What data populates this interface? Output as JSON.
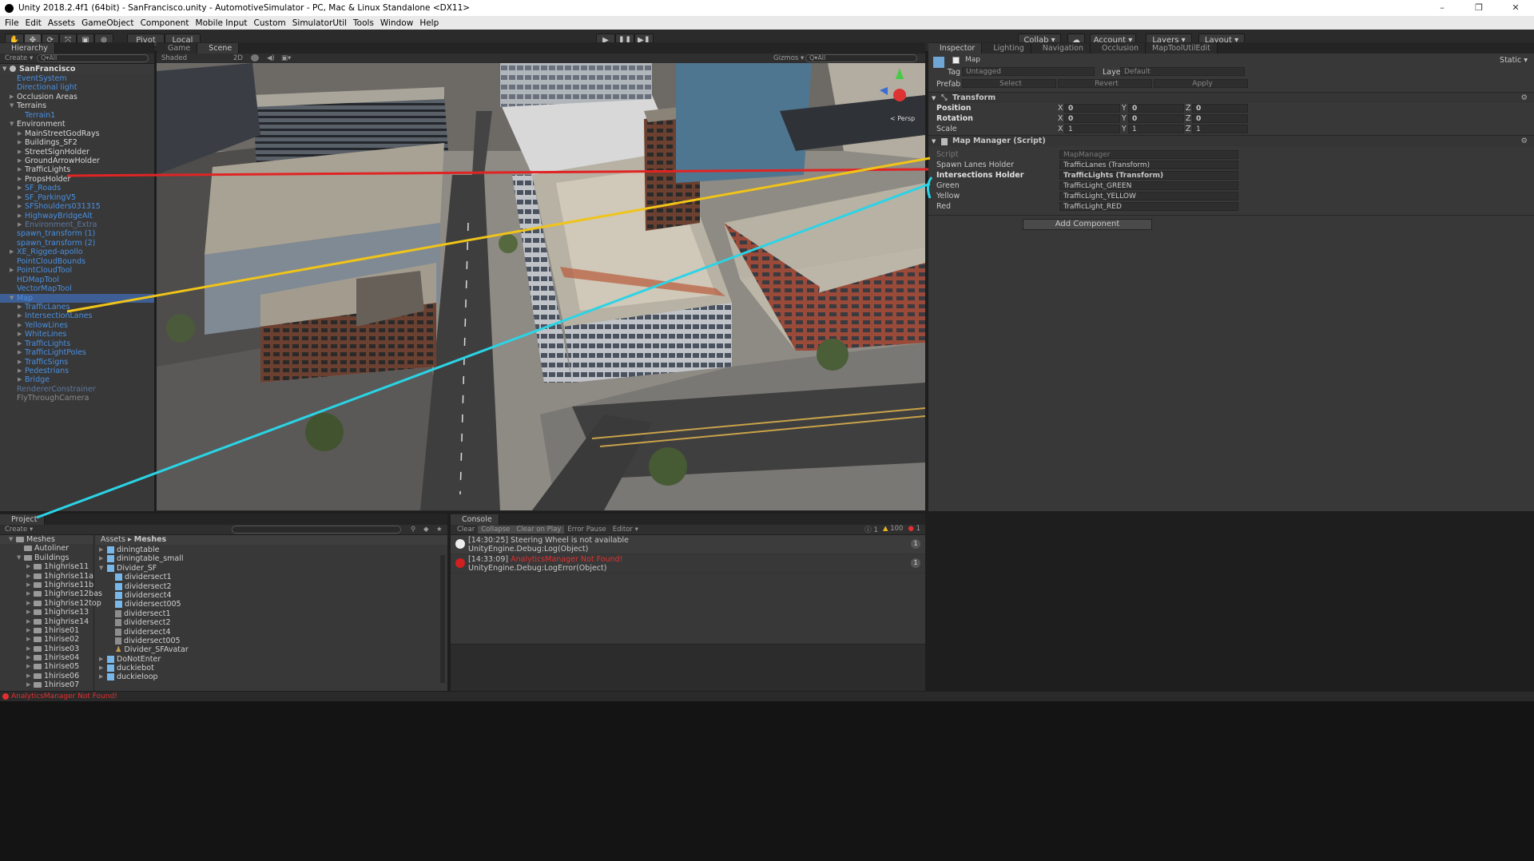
{
  "window": {
    "title": "Unity 2018.2.4f1 (64bit) - SanFrancisco.unity - AutomotiveSimulator - PC, Mac & Linux Standalone <DX11>",
    "controls": [
      "–",
      "❐",
      "✕"
    ]
  },
  "menu": [
    "File",
    "Edit",
    "Assets",
    "GameObject",
    "Component",
    "Mobile Input",
    "Custom",
    "SimulatorUtil",
    "Tools",
    "Window",
    "Help"
  ],
  "toolbar": {
    "pivot": "Pivot",
    "local": "Local",
    "collab": "Collab ▾",
    "account": "Account ▾",
    "layers": "Layers ▾",
    "layout": "Layout ▾"
  },
  "hierarchy": {
    "tab": "Hierarchy",
    "create": "Create ▾",
    "search_placeholder": "Q▾All",
    "scene": "SanFrancisco",
    "items": [
      {
        "label": "EventSystem",
        "indent": 1,
        "color": "blue",
        "arrow": ""
      },
      {
        "label": "Directional light",
        "indent": 1,
        "color": "blue",
        "arrow": ""
      },
      {
        "label": "Occlusion Areas",
        "indent": 1,
        "color": "white",
        "arrow": "▶"
      },
      {
        "label": "Terrains",
        "indent": 1,
        "color": "white",
        "arrow": "▼"
      },
      {
        "label": "Terrain1",
        "indent": 2,
        "color": "blue",
        "arrow": ""
      },
      {
        "label": "Environment",
        "indent": 1,
        "color": "white",
        "arrow": "▼"
      },
      {
        "label": "MainStreetGodRays",
        "indent": 2,
        "color": "white",
        "arrow": "▶"
      },
      {
        "label": "Buildings_SF2",
        "indent": 2,
        "color": "white",
        "arrow": "▶"
      },
      {
        "label": "StreetSignHolder",
        "indent": 2,
        "color": "white",
        "arrow": "▶"
      },
      {
        "label": "GroundArrowHolder",
        "indent": 2,
        "color": "white",
        "arrow": "▶"
      },
      {
        "label": "TrafficLights",
        "indent": 2,
        "color": "white",
        "arrow": "▶"
      },
      {
        "label": "PropsHolder",
        "indent": 2,
        "color": "white",
        "arrow": "▶"
      },
      {
        "label": "SF_Roads",
        "indent": 2,
        "color": "blue",
        "arrow": "▶"
      },
      {
        "label": "SF_ParkingV5",
        "indent": 2,
        "color": "blue",
        "arrow": "▶"
      },
      {
        "label": "SFShoulders031315",
        "indent": 2,
        "color": "blue",
        "arrow": "▶"
      },
      {
        "label": "HighwayBridgeAlt",
        "indent": 2,
        "color": "blue",
        "arrow": "▶"
      },
      {
        "label": "Environment_Extra",
        "indent": 2,
        "color": "dim",
        "arrow": "▶"
      },
      {
        "label": "spawn_transform (1)",
        "indent": 1,
        "color": "blue",
        "arrow": ""
      },
      {
        "label": "spawn_transform (2)",
        "indent": 1,
        "color": "blue",
        "arrow": ""
      },
      {
        "label": "XE_Rigged-apollo",
        "indent": 1,
        "color": "blue",
        "arrow": "▶"
      },
      {
        "label": "PointCloudBounds",
        "indent": 1,
        "color": "blue",
        "arrow": ""
      },
      {
        "label": "PointCloudTool",
        "indent": 1,
        "color": "blue",
        "arrow": "▶"
      },
      {
        "label": "HDMapTool",
        "indent": 1,
        "color": "blue",
        "arrow": ""
      },
      {
        "label": "VectorMapTool",
        "indent": 1,
        "color": "blue",
        "arrow": ""
      },
      {
        "label": "Map",
        "indent": 1,
        "color": "blue",
        "arrow": "▼",
        "selected": true
      },
      {
        "label": "TrafficLanes",
        "indent": 2,
        "color": "blue",
        "arrow": "▶"
      },
      {
        "label": "IntersectionLanes",
        "indent": 2,
        "color": "blue",
        "arrow": "▶"
      },
      {
        "label": "YellowLines",
        "indent": 2,
        "color": "blue",
        "arrow": "▶"
      },
      {
        "label": "WhiteLines",
        "indent": 2,
        "color": "blue",
        "arrow": "▶"
      },
      {
        "label": "TrafficLights",
        "indent": 2,
        "color": "blue",
        "arrow": "▶"
      },
      {
        "label": "TrafficLightPoles",
        "indent": 2,
        "color": "blue",
        "arrow": "▶"
      },
      {
        "label": "TrafficSigns",
        "indent": 2,
        "color": "blue",
        "arrow": "▶"
      },
      {
        "label": "Pedestrians",
        "indent": 2,
        "color": "blue",
        "arrow": "▶"
      },
      {
        "label": "Bridge",
        "indent": 2,
        "color": "blue",
        "arrow": "▶"
      },
      {
        "label": "RendererConstrainer",
        "indent": 1,
        "color": "dim",
        "arrow": ""
      },
      {
        "label": "FlyThroughCamera",
        "indent": 1,
        "color": "gray",
        "arrow": ""
      }
    ]
  },
  "scene_view": {
    "tabs": [
      "Game",
      "Scene"
    ],
    "shading": "Shaded",
    "mode_2d": "2D",
    "gizmos": "Gizmos ▾",
    "search_placeholder": "Q▾All",
    "persp": "< Persp"
  },
  "inspector": {
    "tabs": [
      "Inspector",
      "Lighting",
      "Navigation",
      "Occlusion",
      "MapToolUtilEdit"
    ],
    "object_name": "Map",
    "static": "Static ▾",
    "tag_label": "Tag",
    "tag_value": "Untagged",
    "layer_label": "Layer",
    "layer_value": "Default",
    "prefab_label": "Prefab",
    "prefab_select": "Select",
    "prefab_revert": "Revert",
    "prefab_apply": "Apply",
    "transform": {
      "title": "Transform",
      "position_label": "Position",
      "rotation_label": "Rotation",
      "scale_label": "Scale",
      "position": [
        "0",
        "0",
        "0"
      ],
      "rotation": [
        "0",
        "0",
        "0"
      ],
      "scale": [
        "1",
        "1",
        "1"
      ]
    },
    "map_manager": {
      "title": "Map Manager (Script)",
      "script_label": "Script",
      "script_value": "MapManager",
      "spawn_label": "Spawn Lanes Holder",
      "spawn_value": "TrafficLanes (Transform)",
      "intersections_label": "Intersections Holder",
      "intersections_value": "TrafficLights (Transform)",
      "green_label": "Green",
      "green_value": "TrafficLight_GREEN",
      "yellow_label": "Yellow",
      "yellow_value": "TrafficLight_YELLOW",
      "red_label": "Red",
      "red_value": "TrafficLight_RED"
    },
    "add_component": "Add Component"
  },
  "project": {
    "tab": "Project",
    "create": "Create ▾",
    "tree": [
      {
        "label": "Meshes",
        "indent": 1,
        "arrow": "▼"
      },
      {
        "label": "Autoliner",
        "indent": 2,
        "arrow": ""
      },
      {
        "label": "Buildings",
        "indent": 2,
        "arrow": "▼"
      },
      {
        "label": "1highrise11",
        "indent": 3,
        "arrow": "▶"
      },
      {
        "label": "1highrise11a",
        "indent": 3,
        "arrow": "▶"
      },
      {
        "label": "1highrise11b",
        "indent": 3,
        "arrow": "▶"
      },
      {
        "label": "1highrise12bas",
        "indent": 3,
        "arrow": "▶"
      },
      {
        "label": "1highrise12top",
        "indent": 3,
        "arrow": "▶"
      },
      {
        "label": "1highrise13",
        "indent": 3,
        "arrow": "▶"
      },
      {
        "label": "1highrise14",
        "indent": 3,
        "arrow": "▶"
      },
      {
        "label": "1hirise01",
        "indent": 3,
        "arrow": "▶"
      },
      {
        "label": "1hirise02",
        "indent": 3,
        "arrow": "▶"
      },
      {
        "label": "1hirise03",
        "indent": 3,
        "arrow": "▶"
      },
      {
        "label": "1hirise04",
        "indent": 3,
        "arrow": "▶"
      },
      {
        "label": "1hirise05",
        "indent": 3,
        "arrow": "▶"
      },
      {
        "label": "1hirise06",
        "indent": 3,
        "arrow": "▶"
      },
      {
        "label": "1hirise07",
        "indent": 3,
        "arrow": "▶"
      }
    ],
    "breadcrumb_assets": "Assets",
    "breadcrumb_sep": "▸",
    "breadcrumb_meshes": "Meshes",
    "files": [
      {
        "label": "diningtable",
        "indent": 0,
        "icon": "cube",
        "arrow": "▶"
      },
      {
        "label": "diningtable_small",
        "indent": 0,
        "icon": "cube",
        "arrow": "▶"
      },
      {
        "label": "Divider_SF",
        "indent": 0,
        "icon": "cube",
        "arrow": "▼"
      },
      {
        "label": "dividersect1",
        "indent": 1,
        "icon": "cube",
        "arrow": ""
      },
      {
        "label": "dividersect2",
        "indent": 1,
        "icon": "cube",
        "arrow": ""
      },
      {
        "label": "dividersect4",
        "indent": 1,
        "icon": "cube",
        "arrow": ""
      },
      {
        "label": "dividersect005",
        "indent": 1,
        "icon": "cube",
        "arrow": ""
      },
      {
        "label": "dividersect1",
        "indent": 1,
        "icon": "mesh",
        "arrow": ""
      },
      {
        "label": "dividersect2",
        "indent": 1,
        "icon": "mesh",
        "arrow": ""
      },
      {
        "label": "dividersect4",
        "indent": 1,
        "icon": "mesh",
        "arrow": ""
      },
      {
        "label": "dividersect005",
        "indent": 1,
        "icon": "mesh",
        "arrow": ""
      },
      {
        "label": "Divider_SFAvatar",
        "indent": 1,
        "icon": "avatar",
        "arrow": ""
      },
      {
        "label": "DoNotEnter",
        "indent": 0,
        "icon": "cube",
        "arrow": "▶"
      },
      {
        "label": "duckiebot",
        "indent": 0,
        "icon": "cube",
        "arrow": "▶"
      },
      {
        "label": "duckieloop",
        "indent": 0,
        "icon": "cube",
        "arrow": "▶"
      }
    ]
  },
  "console": {
    "tab": "Console",
    "buttons": [
      "Clear",
      "Collapse",
      "Clear on Play",
      "Error Pause",
      "Editor ▾"
    ],
    "counts": {
      "info": "1",
      "warn": "100",
      "error": "1"
    },
    "entries": [
      {
        "type": "info",
        "line1": "[14:30:25] Steering Wheel is not available",
        "line2": "UnityEngine.Debug:Log(Object)",
        "count": "1"
      },
      {
        "type": "error",
        "time": "[14:33:09] ",
        "msg": "AnalyticsManager Not Found!",
        "line2": "UnityEngine.Debug:LogError(Object)",
        "count": "1"
      }
    ]
  },
  "status": {
    "message": "AnalyticsManager Not Found!"
  },
  "colors": {
    "annotation_red": "#e02424",
    "annotation_yellow": "#f0c419",
    "annotation_cyan": "#2ad4e6",
    "selection": "#3e5f96",
    "link_blue": "#4a90e2"
  }
}
